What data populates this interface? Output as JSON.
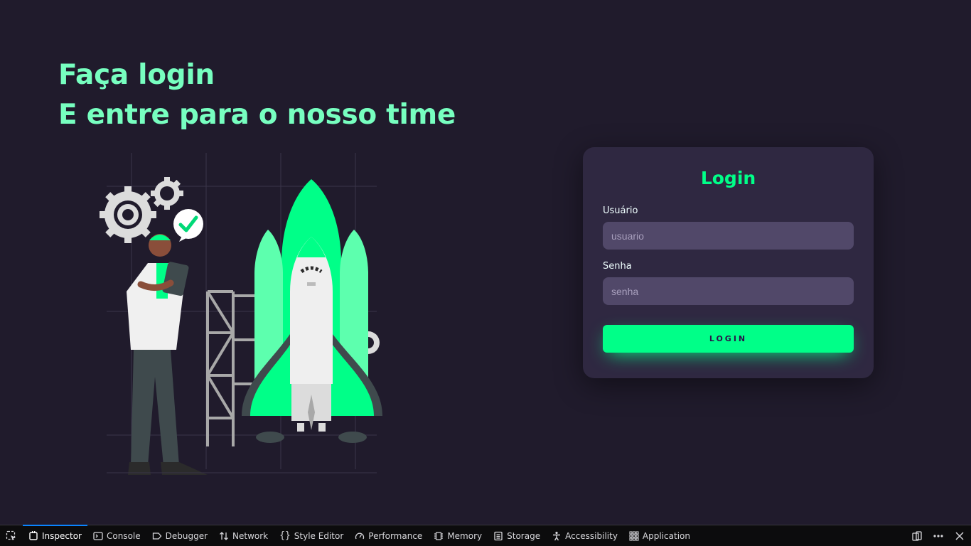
{
  "hero": {
    "line1": "Faça login",
    "line2": "E entre para o nosso time"
  },
  "illustration": {
    "subject": "rocket-launch-illustration"
  },
  "login_card": {
    "title": "Login",
    "username": {
      "label": "Usuário",
      "placeholder": "usuario",
      "value": ""
    },
    "password": {
      "label": "Senha",
      "placeholder": "senha",
      "value": ""
    },
    "submit_label": "LOGIN"
  },
  "colors": {
    "background": "#201b2c",
    "accent": "#00ff88",
    "headline": "#77ffc0",
    "card": "#2f2841",
    "input": "#514869"
  },
  "devtools": {
    "tabs": [
      {
        "label": "Inspector",
        "icon": "inspector-icon"
      },
      {
        "label": "Console",
        "icon": "console-icon"
      },
      {
        "label": "Debugger",
        "icon": "debugger-icon"
      },
      {
        "label": "Network",
        "icon": "network-icon"
      },
      {
        "label": "Style Editor",
        "icon": "style-editor-icon"
      },
      {
        "label": "Performance",
        "icon": "performance-icon"
      },
      {
        "label": "Memory",
        "icon": "memory-icon"
      },
      {
        "label": "Storage",
        "icon": "storage-icon"
      },
      {
        "label": "Accessibility",
        "icon": "accessibility-icon"
      },
      {
        "label": "Application",
        "icon": "application-icon"
      }
    ],
    "active_tab": "Inspector"
  }
}
